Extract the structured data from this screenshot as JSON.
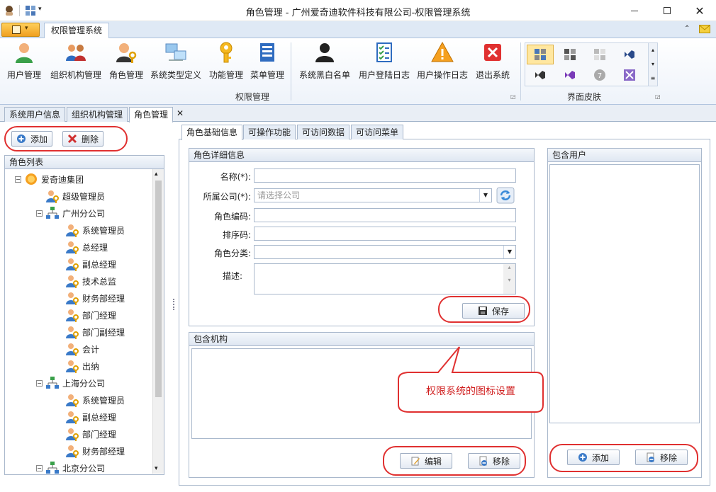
{
  "window": {
    "title": "角色管理 - 广州爱奇迪软件科技有限公司-权限管理系统"
  },
  "ribbon": {
    "tab": "权限管理系统",
    "group_label": "权限管理",
    "skin_label": "界面皮肤",
    "buttons": [
      {
        "label": "用户管理",
        "icon": "user-icon"
      },
      {
        "label": "组织机构管理",
        "icon": "group-icon"
      },
      {
        "label": "角色管理",
        "icon": "role-icon"
      },
      {
        "label": "系统类型定义",
        "icon": "computers-icon"
      },
      {
        "label": "功能管理",
        "icon": "key-icon"
      },
      {
        "label": "菜单管理",
        "icon": "menu-icon"
      },
      {
        "label": "系统黑白名单",
        "icon": "person-icon"
      },
      {
        "label": "用户登陆日志",
        "icon": "checklist-icon"
      },
      {
        "label": "用户操作日志",
        "icon": "warning-icon"
      },
      {
        "label": "退出系统",
        "icon": "close-icon"
      }
    ]
  },
  "doc_tabs": [
    "系统用户信息",
    "组织机构管理",
    "角色管理"
  ],
  "left": {
    "add_label": "添加",
    "delete_label": "删除",
    "list_title": "角色列表",
    "tree": [
      {
        "label": "爱奇迪集团",
        "level": 0,
        "type": "root"
      },
      {
        "label": "超级管理员",
        "level": 1,
        "type": "role"
      },
      {
        "label": "广州分公司",
        "level": 1,
        "type": "org"
      },
      {
        "label": "系统管理员",
        "level": 2,
        "type": "role"
      },
      {
        "label": "总经理",
        "level": 2,
        "type": "role"
      },
      {
        "label": "副总经理",
        "level": 2,
        "type": "role"
      },
      {
        "label": "技术总监",
        "level": 2,
        "type": "role"
      },
      {
        "label": "财务部经理",
        "level": 2,
        "type": "role"
      },
      {
        "label": "部门经理",
        "level": 2,
        "type": "role"
      },
      {
        "label": "部门副经理",
        "level": 2,
        "type": "role"
      },
      {
        "label": "会计",
        "level": 2,
        "type": "role"
      },
      {
        "label": "出纳",
        "level": 2,
        "type": "role"
      },
      {
        "label": "上海分公司",
        "level": 1,
        "type": "org"
      },
      {
        "label": "系统管理员",
        "level": 2,
        "type": "role"
      },
      {
        "label": "副总经理",
        "level": 2,
        "type": "role"
      },
      {
        "label": "部门经理",
        "level": 2,
        "type": "role"
      },
      {
        "label": "财务部经理",
        "level": 2,
        "type": "role"
      },
      {
        "label": "北京分公司",
        "level": 1,
        "type": "org"
      }
    ]
  },
  "sub_tabs": [
    "角色基础信息",
    "可操作功能",
    "可访问数据",
    "可访问菜单"
  ],
  "detail": {
    "title": "角色详细信息",
    "name_label": "名称(*):",
    "company_label": "所属公司(*):",
    "company_placeholder": "请选择公司",
    "code_label": "角色编码:",
    "sort_label": "排序码:",
    "category_label": "角色分类:",
    "desc_label": "描述:",
    "save_label": "保存"
  },
  "orgs": {
    "title": "包含机构",
    "edit_label": "编辑",
    "remove_label": "移除"
  },
  "users": {
    "title": "包含用户",
    "add_label": "添加",
    "remove_label": "移除"
  },
  "callout": {
    "text": "权限系统的图标设置"
  }
}
